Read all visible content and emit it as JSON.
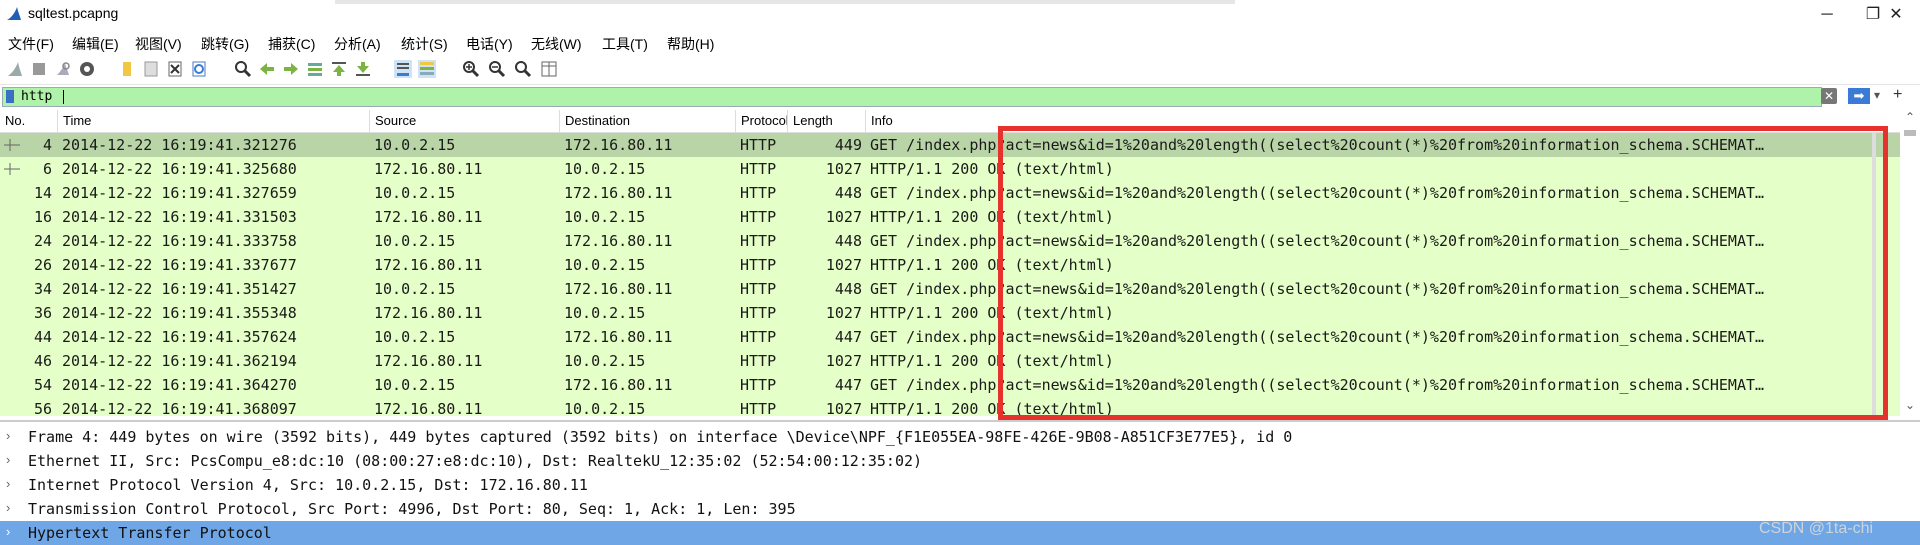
{
  "window": {
    "title": "sqltest.pcapng",
    "minimize": "─",
    "restore": "❐",
    "close": "✕"
  },
  "menu": [
    "文件(F)",
    "编辑(E)",
    "视图(V)",
    "跳转(G)",
    "捕获(C)",
    "分析(A)",
    "统计(S)",
    "电话(Y)",
    "无线(W)",
    "工具(T)",
    "帮助(H)"
  ],
  "toolbar_icons": [
    "shark-fin-start-icon",
    "stop-icon",
    "restart-icon",
    "options-gear-icon",
    "open-folder-icon",
    "save-icon",
    "close-file-icon",
    "reload-icon",
    "find-icon",
    "go-back-icon",
    "go-forward-icon",
    "go-to-packet-icon",
    "go-first-icon",
    "go-last-icon",
    "autoscroll-icon",
    "colorize-icon",
    "zoom-in-icon",
    "zoom-out-icon",
    "zoom-normal-icon",
    "resize-columns-icon"
  ],
  "filter": {
    "value": "http",
    "clear": "✕",
    "apply": "➡",
    "add": "+"
  },
  "columns": [
    "No.",
    "Time",
    "Source",
    "Destination",
    "Protocol",
    "Length",
    "Info"
  ],
  "packets": [
    {
      "no": "4",
      "time": "2014-12-22 16:19:41.321276",
      "src": "10.0.2.15",
      "dst": "172.16.80.11",
      "proto": "HTTP",
      "len": "449",
      "info": "GET /index.php?act=news&id=1%20and%20length((select%20count(*)%20from%20information_schema.SCHEMAT…"
    },
    {
      "no": "6",
      "time": "2014-12-22 16:19:41.325680",
      "src": "172.16.80.11",
      "dst": "10.0.2.15",
      "proto": "HTTP",
      "len": "1027",
      "info": "HTTP/1.1 200 OK  (text/html)"
    },
    {
      "no": "14",
      "time": "2014-12-22 16:19:41.327659",
      "src": "10.0.2.15",
      "dst": "172.16.80.11",
      "proto": "HTTP",
      "len": "448",
      "info": "GET /index.php?act=news&id=1%20and%20length((select%20count(*)%20from%20information_schema.SCHEMAT…"
    },
    {
      "no": "16",
      "time": "2014-12-22 16:19:41.331503",
      "src": "172.16.80.11",
      "dst": "10.0.2.15",
      "proto": "HTTP",
      "len": "1027",
      "info": "HTTP/1.1 200 OK  (text/html)"
    },
    {
      "no": "24",
      "time": "2014-12-22 16:19:41.333758",
      "src": "10.0.2.15",
      "dst": "172.16.80.11",
      "proto": "HTTP",
      "len": "448",
      "info": "GET /index.php?act=news&id=1%20and%20length((select%20count(*)%20from%20information_schema.SCHEMAT…"
    },
    {
      "no": "26",
      "time": "2014-12-22 16:19:41.337677",
      "src": "172.16.80.11",
      "dst": "10.0.2.15",
      "proto": "HTTP",
      "len": "1027",
      "info": "HTTP/1.1 200 OK  (text/html)"
    },
    {
      "no": "34",
      "time": "2014-12-22 16:19:41.351427",
      "src": "10.0.2.15",
      "dst": "172.16.80.11",
      "proto": "HTTP",
      "len": "448",
      "info": "GET /index.php?act=news&id=1%20and%20length((select%20count(*)%20from%20information_schema.SCHEMAT…"
    },
    {
      "no": "36",
      "time": "2014-12-22 16:19:41.355348",
      "src": "172.16.80.11",
      "dst": "10.0.2.15",
      "proto": "HTTP",
      "len": "1027",
      "info": "HTTP/1.1 200 OK  (text/html)"
    },
    {
      "no": "44",
      "time": "2014-12-22 16:19:41.357624",
      "src": "10.0.2.15",
      "dst": "172.16.80.11",
      "proto": "HTTP",
      "len": "447",
      "info": "GET /index.php?act=news&id=1%20and%20length((select%20count(*)%20from%20information_schema.SCHEMAT…"
    },
    {
      "no": "46",
      "time": "2014-12-22 16:19:41.362194",
      "src": "172.16.80.11",
      "dst": "10.0.2.15",
      "proto": "HTTP",
      "len": "1027",
      "info": "HTTP/1.1 200 OK  (text/html)"
    },
    {
      "no": "54",
      "time": "2014-12-22 16:19:41.364270",
      "src": "10.0.2.15",
      "dst": "172.16.80.11",
      "proto": "HTTP",
      "len": "447",
      "info": "GET /index.php?act=news&id=1%20and%20length((select%20count(*)%20from%20information_schema.SCHEMAT…"
    },
    {
      "no": "56",
      "time": "2014-12-22 16:19:41.368097",
      "src": "172.16.80.11",
      "dst": "10.0.2.15",
      "proto": "HTTP",
      "len": "1027",
      "info": "HTTP/1.1 200 OK  (text/html)"
    }
  ],
  "details": [
    "Frame 4: 449 bytes on wire (3592 bits), 449 bytes captured (3592 bits) on interface \\Device\\NPF_{F1E055EA-98FE-426E-9B08-A851CF3E77E5}, id 0",
    "Ethernet II, Src: PcsCompu_e8:dc:10 (08:00:27:e8:dc:10), Dst: RealtekU_12:35:02 (52:54:00:12:35:02)",
    "Internet Protocol Version 4, Src: 10.0.2.15, Dst: 172.16.80.11",
    "Transmission Control Protocol, Src Port: 4996, Dst Port: 80, Seq: 1, Ack: 1, Len: 395",
    "Hypertext Transfer Protocol"
  ],
  "watermark": "CSDN @1ta-chi",
  "colors": {
    "row_bg": "#e4ffc7",
    "row_selected": "#b9d4a6",
    "filter_bg": "#aff2a9",
    "detail_selected": "#6fa7e6",
    "highlight_box": "#e5322d"
  }
}
